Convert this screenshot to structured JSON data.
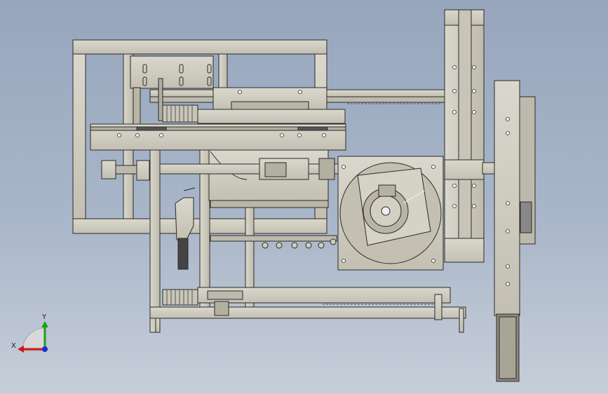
{
  "triad": {
    "x_label": "X",
    "y_label": "Y"
  },
  "colors": {
    "background_top": "#97a6bd",
    "background_bottom": "#c6ced9",
    "part_fill": "#cfccc0",
    "part_fill_dark": "#b9b6a8",
    "edge": "#2a2a28",
    "axis_x": "#d01818",
    "axis_y": "#18a018",
    "axis_z": "#1830d0"
  }
}
